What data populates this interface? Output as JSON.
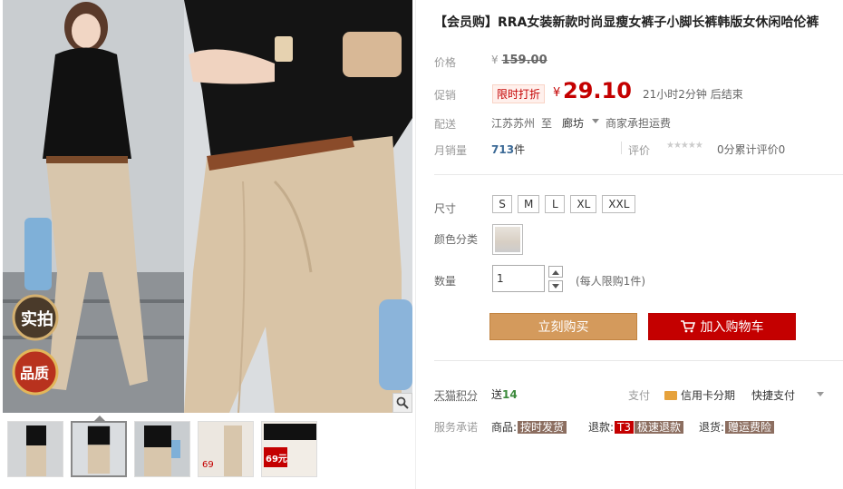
{
  "gallery": {
    "main_image_alt": "",
    "badges": [
      "实拍",
      "品质"
    ],
    "thumbs": [
      {
        "alt": ""
      },
      {
        "alt": ""
      },
      {
        "alt": ""
      },
      {
        "alt": "69"
      },
      {
        "alt": "69元"
      }
    ]
  },
  "product": {
    "title": "【会员购】RRA女装新款时尚显瘦女裤子小脚长裤韩版女休闲哈伦裤",
    "price_label": "价格",
    "yen": "¥",
    "original_price": "159.00",
    "promo_label": "促销",
    "promo_tag": "限时打折",
    "promo_price": "29.10",
    "promo_time": "21小时2分钟 后结束",
    "ship_label": "配送",
    "ship_from": "江苏苏州",
    "ship_to_word": "至",
    "ship_to": "廊坊",
    "ship_fee": "商家承担运费",
    "sales_label": "月销量",
    "sales_count": "713",
    "sales_unit": "件",
    "rating_label": "评价",
    "stars": "★★★★★",
    "review_text": "0分累计评价0"
  },
  "options": {
    "size_label": "尺寸",
    "sizes": [
      "S",
      "M",
      "L",
      "XL",
      "XXL"
    ],
    "color_label": "颜色分类",
    "qty_label": "数量",
    "qty_value": "1",
    "qty_limit": "(每人限购1件)"
  },
  "actions": {
    "buy_now": "立刻购买",
    "add_cart": "加入购物车"
  },
  "extras": {
    "points_label": "天猫积分",
    "points_prefix": "送",
    "points_value": "14",
    "pay_label": "支付",
    "pay_card": "信用卡分期",
    "pay_quick": "快捷支付",
    "service_label": "服务承诺",
    "svc1_prefix": "商品:",
    "svc1_tag": "按时发货",
    "svc2_prefix": "退款:",
    "svc2_tag_a": "T3",
    "svc2_tag_b": "极速退款",
    "svc3_prefix": "退货:",
    "svc3_tag": "赠运费险"
  },
  "colors": {
    "price_red": "#c40000",
    "buy_now_bg": "#d49a5c",
    "add_cart_bg": "#c40000",
    "link_blue": "#3c6a96"
  }
}
